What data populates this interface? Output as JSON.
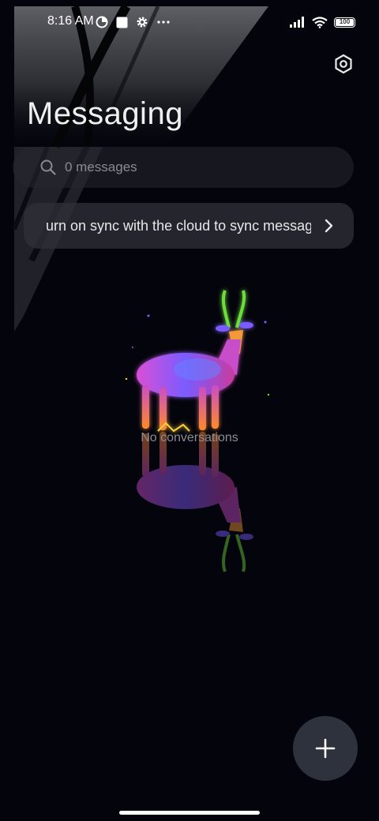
{
  "status_bar": {
    "time": "8:16 AM",
    "battery": "100",
    "icons": [
      "data-saver-icon",
      "square-notification-icon",
      "gear-icon",
      "more-dots-icon",
      "signal-icon",
      "wifi-icon",
      "battery-icon"
    ]
  },
  "header": {
    "title": "Messaging",
    "settings_icon": "hexagon-settings-icon"
  },
  "search": {
    "placeholder": "0 messages"
  },
  "sync_banner": {
    "text": "urn on sync with the cloud to sync messag"
  },
  "empty_state": {
    "text": "No conversations"
  },
  "fab": {
    "icon": "plus-icon"
  },
  "colors": {
    "background": "#04040c",
    "card": "#303038",
    "fab": "#2e323c",
    "muted_text": "#8c8c92"
  }
}
